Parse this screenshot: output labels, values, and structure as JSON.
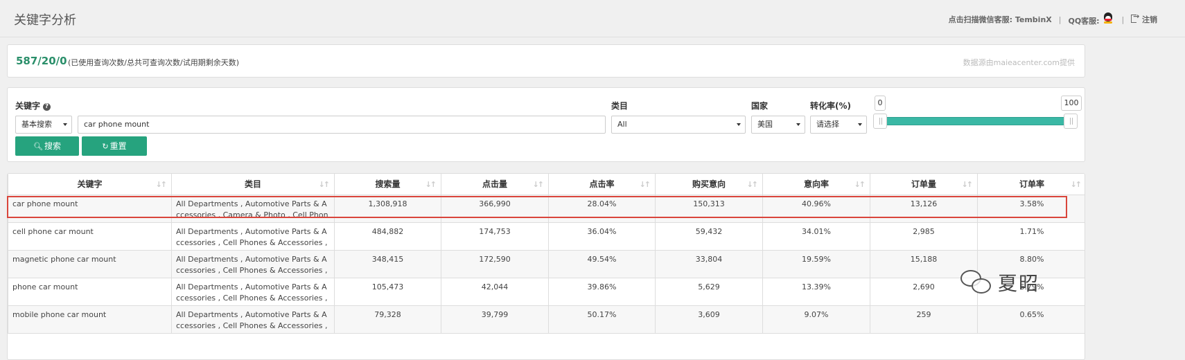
{
  "header": {
    "title": "关键字分析",
    "wechat_label": "点击扫描微信客服:",
    "wechat_name": "TembinX",
    "qq_label": "QQ客服:",
    "logout_label": "注销"
  },
  "usage": {
    "count": "587/20/0",
    "description": "(已使用查询次数/总共可查询次数/试用期剩余天数)",
    "source": "数据源由maieacenter.com提供"
  },
  "search": {
    "keyword_label": "关键字",
    "search_mode": "基本搜索",
    "keyword_value": "car phone mount",
    "category_label": "类目",
    "category_value": "All",
    "country_label": "国家",
    "country_value": "美国",
    "conversion_label": "转化率(%)",
    "conversion_value": "请选择",
    "search_button": "搜索",
    "reset_button": "重置",
    "slider_min": "0",
    "slider_max": "100"
  },
  "table": {
    "columns": [
      "关键字",
      "类目",
      "搜索量",
      "点击量",
      "点击率",
      "购买意向",
      "意向率",
      "订单量",
      "订单率"
    ],
    "rows": [
      {
        "keyword": "car phone mount",
        "category": "All Departments , Automotive Parts & Accessories , Camera & Photo , Cell Phones & Accessories",
        "search": "1,308,918",
        "clicks": "366,990",
        "ctr": "28.04%",
        "intent": "150,313",
        "intent_rate": "40.96%",
        "orders": "13,126",
        "order_rate": "3.58%"
      },
      {
        "keyword": "cell phone car mount",
        "category": "All Departments , Automotive Parts & Accessories , Cell Phones & Accessories , Electronics",
        "search": "484,882",
        "clicks": "174,753",
        "ctr": "36.04%",
        "intent": "59,432",
        "intent_rate": "34.01%",
        "orders": "2,985",
        "order_rate": "1.71%"
      },
      {
        "keyword": "magnetic phone car mount",
        "category": "All Departments , Automotive Parts & Accessories , Cell Phones & Accessories , Electronics",
        "search": "348,415",
        "clicks": "172,590",
        "ctr": "49.54%",
        "intent": "33,804",
        "intent_rate": "19.59%",
        "orders": "15,188",
        "order_rate": "8.80%"
      },
      {
        "keyword": "phone car mount",
        "category": "All Departments , Automotive Parts & Accessories , Cell Phones & Accessories , Electronics",
        "search": "105,473",
        "clicks": "42,044",
        "ctr": "39.86%",
        "intent": "5,629",
        "intent_rate": "13.39%",
        "orders": "2,690",
        "order_rate": "6.79%"
      },
      {
        "keyword": "mobile phone car mount",
        "category": "All Departments , Automotive Parts & Accessories , Cell Phones & Accessories , Electronics",
        "search": "79,328",
        "clicks": "39,799",
        "ctr": "50.17%",
        "intent": "3,609",
        "intent_rate": "9.07%",
        "orders": "259",
        "order_rate": "0.65%"
      }
    ]
  },
  "watermark": {
    "text": "夏昭"
  },
  "colors": {
    "accent": "#26a37e",
    "usage_count": "#2a8f6a",
    "highlight": "#d9453b",
    "slider": "#3ab8a5"
  }
}
